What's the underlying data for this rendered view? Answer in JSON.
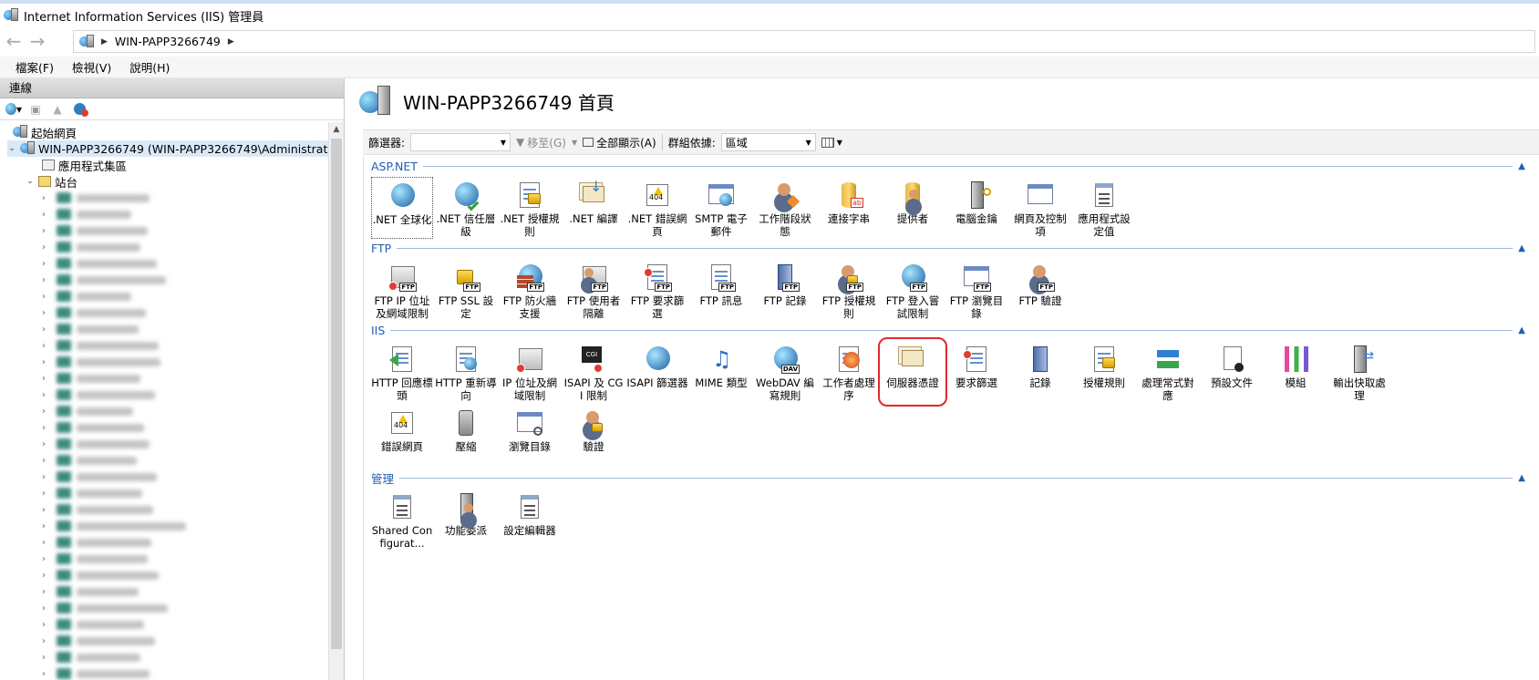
{
  "window": {
    "title": "Internet Information Services (IIS) 管理員"
  },
  "address": {
    "segments": [
      "WIN-PAPP3266749"
    ]
  },
  "menu": {
    "items": [
      "檔案(F)",
      "檢視(V)",
      "說明(H)"
    ]
  },
  "connections": {
    "header": "連線",
    "tree": {
      "start_page": "起始網頁",
      "server": "WIN-PAPP3266749 (WIN-PAPP3266749\\Administrator)",
      "app_pools": "應用程式集區",
      "sites": "站台"
    }
  },
  "main": {
    "title": "WIN-PAPP3266749 首頁",
    "filterbar": {
      "filter_label": "篩選器:",
      "filter_value": "",
      "go_label": "移至(G)",
      "show_all_label": "全部顯示(A)",
      "group_by_label": "群組依據:",
      "group_by_value": "區域"
    },
    "sections": [
      {
        "title": "ASP.NET",
        "features": [
          {
            "label": ".NET 全球化",
            "icon": "globe-icon"
          },
          {
            "label": ".NET 信任層級",
            "icon": "globe-check-icon"
          },
          {
            "label": ".NET 授權規則",
            "icon": "doc-lock-icon"
          },
          {
            "label": ".NET 編譯",
            "icon": "compile-icon"
          },
          {
            "label": ".NET 錯誤網頁",
            "icon": "error-page-icon"
          },
          {
            "label": "SMTP 電子郵件",
            "icon": "smtp-icon"
          },
          {
            "label": "工作階段狀態",
            "icon": "session-icon"
          },
          {
            "label": "連接字串",
            "icon": "connection-string-icon"
          },
          {
            "label": "提供者",
            "icon": "providers-icon"
          },
          {
            "label": "電腦金鑰",
            "icon": "machine-key-icon"
          },
          {
            "label": "網頁及控制項",
            "icon": "pages-controls-icon"
          },
          {
            "label": "應用程式設定值",
            "icon": "app-settings-icon"
          }
        ]
      },
      {
        "title": "FTP",
        "features": [
          {
            "label": "FTP IP 位址及網域限制",
            "icon": "ftp-ip-icon"
          },
          {
            "label": "FTP SSL 設定",
            "icon": "ftp-ssl-icon"
          },
          {
            "label": "FTP 防火牆支援",
            "icon": "ftp-firewall-icon"
          },
          {
            "label": "FTP 使用者隔離",
            "icon": "ftp-user-isolation-icon"
          },
          {
            "label": "FTP 要求篩選",
            "icon": "ftp-request-filter-icon"
          },
          {
            "label": "FTP 訊息",
            "icon": "ftp-messages-icon"
          },
          {
            "label": "FTP 記錄",
            "icon": "ftp-logging-icon"
          },
          {
            "label": "FTP 授權規則",
            "icon": "ftp-authorization-icon"
          },
          {
            "label": "FTP 登入嘗試限制",
            "icon": "ftp-logon-attempt-icon"
          },
          {
            "label": "FTP 瀏覽目錄",
            "icon": "ftp-directory-browsing-icon"
          },
          {
            "label": "FTP 驗證",
            "icon": "ftp-authentication-icon"
          }
        ]
      },
      {
        "title": "IIS",
        "features": [
          {
            "label": "HTTP 回應標頭",
            "icon": "http-headers-icon"
          },
          {
            "label": "HTTP 重新導向",
            "icon": "http-redirect-icon"
          },
          {
            "label": "IP 位址及網域限制",
            "icon": "ip-restrictions-icon"
          },
          {
            "label": "ISAPI 及 CGI 限制",
            "icon": "isapi-cgi-icon"
          },
          {
            "label": "ISAPI 篩選器",
            "icon": "isapi-filters-icon"
          },
          {
            "label": "MIME 類型",
            "icon": "mime-types-icon"
          },
          {
            "label": "WebDAV 編寫規則",
            "icon": "webdav-icon"
          },
          {
            "label": "工作者處理序",
            "icon": "worker-process-icon"
          },
          {
            "label": "伺服器憑證",
            "icon": "server-certificates-icon"
          },
          {
            "label": "要求篩選",
            "icon": "request-filtering-icon"
          },
          {
            "label": "記錄",
            "icon": "logging-icon"
          },
          {
            "label": "授權規則",
            "icon": "authorization-rules-icon"
          },
          {
            "label": "處理常式對應",
            "icon": "handler-mappings-icon"
          },
          {
            "label": "預設文件",
            "icon": "default-document-icon"
          },
          {
            "label": "模組",
            "icon": "modules-icon"
          },
          {
            "label": "輸出快取處理",
            "icon": "output-caching-icon"
          },
          {
            "label": "錯誤網頁",
            "icon": "error-pages-icon"
          },
          {
            "label": "壓縮",
            "icon": "compression-icon"
          },
          {
            "label": "瀏覽目錄",
            "icon": "directory-browsing-icon"
          },
          {
            "label": "驗證",
            "icon": "authentication-icon"
          }
        ]
      },
      {
        "title": "管理",
        "features": [
          {
            "label": "Shared Configurat...",
            "icon": "shared-configuration-icon"
          },
          {
            "label": "功能委派",
            "icon": "feature-delegation-icon"
          },
          {
            "label": "設定編輯器",
            "icon": "configuration-editor-icon"
          }
        ]
      }
    ]
  },
  "colors": {
    "section_title": "#1f5fae",
    "highlight": "#e0282e"
  }
}
